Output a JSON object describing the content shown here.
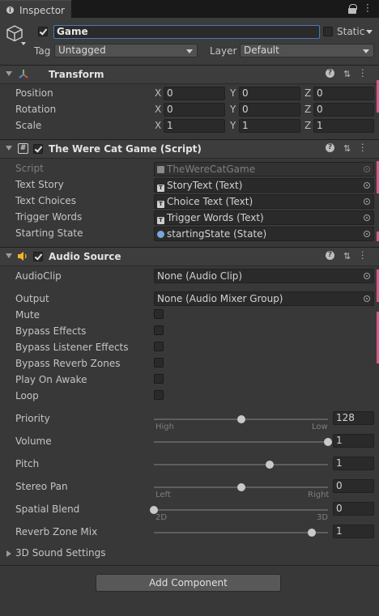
{
  "tab": {
    "title": "Inspector",
    "icon": "info-icon"
  },
  "window_icons": [
    "lock-icon",
    "kebab-menu-icon"
  ],
  "gameobject": {
    "active": true,
    "name": "Game",
    "static_label": "Static",
    "static": false,
    "tag_label": "Tag",
    "tag_value": "Untagged",
    "layer_label": "Layer",
    "layer_value": "Default",
    "icon": "cube-icon"
  },
  "transform": {
    "title": "Transform",
    "icon": "transform-icon",
    "rows": [
      {
        "label": "Position",
        "x": "0",
        "y": "0",
        "z": "0"
      },
      {
        "label": "Rotation",
        "x": "0",
        "y": "0",
        "z": "0"
      },
      {
        "label": "Scale",
        "x": "1",
        "y": "1",
        "z": "1"
      }
    ],
    "axis": {
      "x": "X",
      "y": "Y",
      "z": "Z"
    }
  },
  "script": {
    "title": "The Were Cat Game (Script)",
    "enabled": true,
    "icon": "script-hash-icon",
    "rows": [
      {
        "label": "Script",
        "value": "TheWereCatGame",
        "icon": "script-file-icon"
      },
      {
        "label": "Text Story",
        "value": "StoryText (Text)",
        "icon": "text-icon"
      },
      {
        "label": "Text Choices",
        "value": "Choice Text (Text)",
        "icon": "text-icon"
      },
      {
        "label": "Trigger Words",
        "value": "Trigger Words (Text)",
        "icon": "text-icon"
      },
      {
        "label": "Starting State",
        "value": "startingState (State)",
        "icon": "state-asset-icon"
      }
    ]
  },
  "audio": {
    "title": "Audio Source",
    "enabled": true,
    "icon": "speaker-icon",
    "audio_clip_label": "AudioClip",
    "audio_clip_value": "None (Audio Clip)",
    "output_label": "Output",
    "output_value": "None (Audio Mixer Group)",
    "toggles": [
      {
        "label": "Mute",
        "checked": false
      },
      {
        "label": "Bypass Effects",
        "checked": false
      },
      {
        "label": "Bypass Listener Effects",
        "checked": false
      },
      {
        "label": "Bypass Reverb Zones",
        "checked": false
      },
      {
        "label": "Play On Awake",
        "checked": false
      },
      {
        "label": "Loop",
        "checked": false
      }
    ],
    "sliders": [
      {
        "label": "Priority",
        "value": "128",
        "min_label": "High",
        "max_label": "Low",
        "fraction": 0.5
      },
      {
        "label": "Volume",
        "value": "1",
        "min_label": "",
        "max_label": "",
        "fraction": 1.0
      },
      {
        "label": "Pitch",
        "value": "1",
        "min_label": "",
        "max_label": "",
        "fraction": 0.667
      },
      {
        "label": "Stereo Pan",
        "value": "0",
        "min_label": "Left",
        "max_label": "Right",
        "fraction": 0.5
      },
      {
        "label": "Spatial Blend",
        "value": "0",
        "min_label": "2D",
        "max_label": "3D",
        "fraction": 0.0
      },
      {
        "label": "Reverb Zone Mix",
        "value": "1",
        "min_label": "",
        "max_label": "",
        "fraction": 0.909
      }
    ],
    "sound_settings_label": "3D Sound Settings"
  },
  "add_component_label": "Add Component"
}
